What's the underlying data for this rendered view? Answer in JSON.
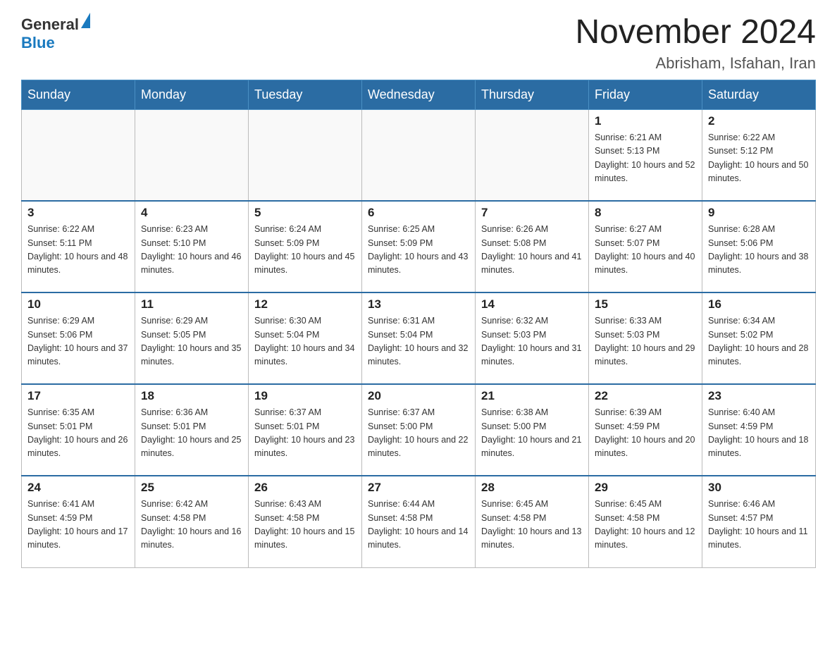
{
  "header": {
    "logo_text_general": "General",
    "logo_text_blue": "Blue",
    "month_title": "November 2024",
    "location": "Abrisham, Isfahan, Iran"
  },
  "weekdays": [
    "Sunday",
    "Monday",
    "Tuesday",
    "Wednesday",
    "Thursday",
    "Friday",
    "Saturday"
  ],
  "weeks": [
    [
      {
        "day": "",
        "sunrise": "",
        "sunset": "",
        "daylight": ""
      },
      {
        "day": "",
        "sunrise": "",
        "sunset": "",
        "daylight": ""
      },
      {
        "day": "",
        "sunrise": "",
        "sunset": "",
        "daylight": ""
      },
      {
        "day": "",
        "sunrise": "",
        "sunset": "",
        "daylight": ""
      },
      {
        "day": "",
        "sunrise": "",
        "sunset": "",
        "daylight": ""
      },
      {
        "day": "1",
        "sunrise": "Sunrise: 6:21 AM",
        "sunset": "Sunset: 5:13 PM",
        "daylight": "Daylight: 10 hours and 52 minutes."
      },
      {
        "day": "2",
        "sunrise": "Sunrise: 6:22 AM",
        "sunset": "Sunset: 5:12 PM",
        "daylight": "Daylight: 10 hours and 50 minutes."
      }
    ],
    [
      {
        "day": "3",
        "sunrise": "Sunrise: 6:22 AM",
        "sunset": "Sunset: 5:11 PM",
        "daylight": "Daylight: 10 hours and 48 minutes."
      },
      {
        "day": "4",
        "sunrise": "Sunrise: 6:23 AM",
        "sunset": "Sunset: 5:10 PM",
        "daylight": "Daylight: 10 hours and 46 minutes."
      },
      {
        "day": "5",
        "sunrise": "Sunrise: 6:24 AM",
        "sunset": "Sunset: 5:09 PM",
        "daylight": "Daylight: 10 hours and 45 minutes."
      },
      {
        "day": "6",
        "sunrise": "Sunrise: 6:25 AM",
        "sunset": "Sunset: 5:09 PM",
        "daylight": "Daylight: 10 hours and 43 minutes."
      },
      {
        "day": "7",
        "sunrise": "Sunrise: 6:26 AM",
        "sunset": "Sunset: 5:08 PM",
        "daylight": "Daylight: 10 hours and 41 minutes."
      },
      {
        "day": "8",
        "sunrise": "Sunrise: 6:27 AM",
        "sunset": "Sunset: 5:07 PM",
        "daylight": "Daylight: 10 hours and 40 minutes."
      },
      {
        "day": "9",
        "sunrise": "Sunrise: 6:28 AM",
        "sunset": "Sunset: 5:06 PM",
        "daylight": "Daylight: 10 hours and 38 minutes."
      }
    ],
    [
      {
        "day": "10",
        "sunrise": "Sunrise: 6:29 AM",
        "sunset": "Sunset: 5:06 PM",
        "daylight": "Daylight: 10 hours and 37 minutes."
      },
      {
        "day": "11",
        "sunrise": "Sunrise: 6:29 AM",
        "sunset": "Sunset: 5:05 PM",
        "daylight": "Daylight: 10 hours and 35 minutes."
      },
      {
        "day": "12",
        "sunrise": "Sunrise: 6:30 AM",
        "sunset": "Sunset: 5:04 PM",
        "daylight": "Daylight: 10 hours and 34 minutes."
      },
      {
        "day": "13",
        "sunrise": "Sunrise: 6:31 AM",
        "sunset": "Sunset: 5:04 PM",
        "daylight": "Daylight: 10 hours and 32 minutes."
      },
      {
        "day": "14",
        "sunrise": "Sunrise: 6:32 AM",
        "sunset": "Sunset: 5:03 PM",
        "daylight": "Daylight: 10 hours and 31 minutes."
      },
      {
        "day": "15",
        "sunrise": "Sunrise: 6:33 AM",
        "sunset": "Sunset: 5:03 PM",
        "daylight": "Daylight: 10 hours and 29 minutes."
      },
      {
        "day": "16",
        "sunrise": "Sunrise: 6:34 AM",
        "sunset": "Sunset: 5:02 PM",
        "daylight": "Daylight: 10 hours and 28 minutes."
      }
    ],
    [
      {
        "day": "17",
        "sunrise": "Sunrise: 6:35 AM",
        "sunset": "Sunset: 5:01 PM",
        "daylight": "Daylight: 10 hours and 26 minutes."
      },
      {
        "day": "18",
        "sunrise": "Sunrise: 6:36 AM",
        "sunset": "Sunset: 5:01 PM",
        "daylight": "Daylight: 10 hours and 25 minutes."
      },
      {
        "day": "19",
        "sunrise": "Sunrise: 6:37 AM",
        "sunset": "Sunset: 5:01 PM",
        "daylight": "Daylight: 10 hours and 23 minutes."
      },
      {
        "day": "20",
        "sunrise": "Sunrise: 6:37 AM",
        "sunset": "Sunset: 5:00 PM",
        "daylight": "Daylight: 10 hours and 22 minutes."
      },
      {
        "day": "21",
        "sunrise": "Sunrise: 6:38 AM",
        "sunset": "Sunset: 5:00 PM",
        "daylight": "Daylight: 10 hours and 21 minutes."
      },
      {
        "day": "22",
        "sunrise": "Sunrise: 6:39 AM",
        "sunset": "Sunset: 4:59 PM",
        "daylight": "Daylight: 10 hours and 20 minutes."
      },
      {
        "day": "23",
        "sunrise": "Sunrise: 6:40 AM",
        "sunset": "Sunset: 4:59 PM",
        "daylight": "Daylight: 10 hours and 18 minutes."
      }
    ],
    [
      {
        "day": "24",
        "sunrise": "Sunrise: 6:41 AM",
        "sunset": "Sunset: 4:59 PM",
        "daylight": "Daylight: 10 hours and 17 minutes."
      },
      {
        "day": "25",
        "sunrise": "Sunrise: 6:42 AM",
        "sunset": "Sunset: 4:58 PM",
        "daylight": "Daylight: 10 hours and 16 minutes."
      },
      {
        "day": "26",
        "sunrise": "Sunrise: 6:43 AM",
        "sunset": "Sunset: 4:58 PM",
        "daylight": "Daylight: 10 hours and 15 minutes."
      },
      {
        "day": "27",
        "sunrise": "Sunrise: 6:44 AM",
        "sunset": "Sunset: 4:58 PM",
        "daylight": "Daylight: 10 hours and 14 minutes."
      },
      {
        "day": "28",
        "sunrise": "Sunrise: 6:45 AM",
        "sunset": "Sunset: 4:58 PM",
        "daylight": "Daylight: 10 hours and 13 minutes."
      },
      {
        "day": "29",
        "sunrise": "Sunrise: 6:45 AM",
        "sunset": "Sunset: 4:58 PM",
        "daylight": "Daylight: 10 hours and 12 minutes."
      },
      {
        "day": "30",
        "sunrise": "Sunrise: 6:46 AM",
        "sunset": "Sunset: 4:57 PM",
        "daylight": "Daylight: 10 hours and 11 minutes."
      }
    ]
  ]
}
